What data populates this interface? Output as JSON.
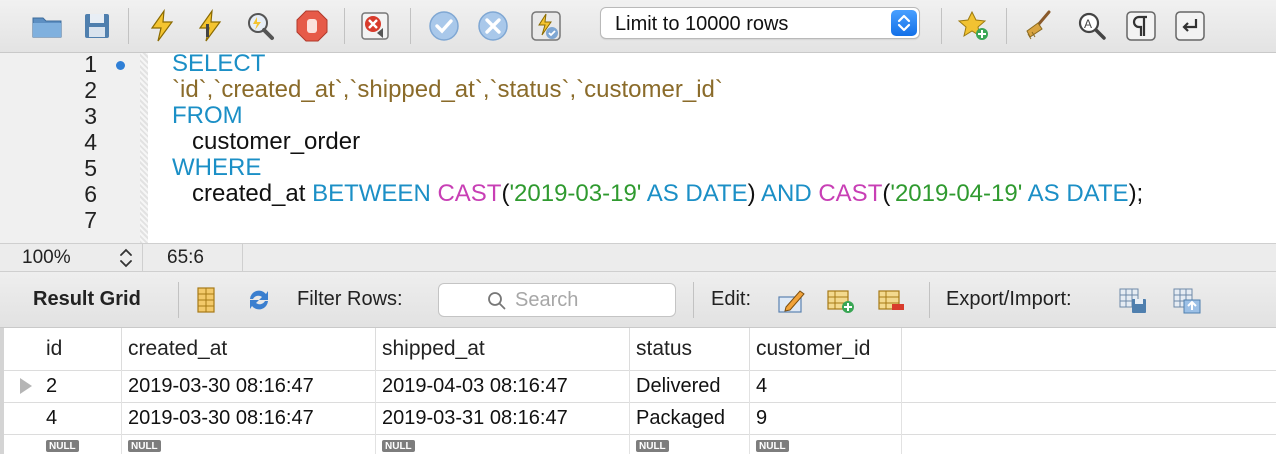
{
  "toolbar": {
    "icons": [
      "open-folder-icon",
      "save-icon",
      "execute-icon",
      "execute-current-icon",
      "explain-icon",
      "stop-icon",
      "toggle-error-icon",
      "commit-icon",
      "rollback-icon",
      "autocommit-icon",
      "add-snippet-icon",
      "beautify-icon",
      "find-icon",
      "invisible-chars-icon",
      "word-wrap-icon"
    ],
    "limit_label": "Limit to 10000 rows"
  },
  "editor": {
    "line_numbers": [
      "1",
      "2",
      "3",
      "4",
      "5",
      "6",
      "7"
    ],
    "lines": [
      [
        {
          "t": "SELECT",
          "c": "kw"
        }
      ],
      [
        {
          "t": "`id`,`created_at`,`shipped_at`,`status`,`customer_id`",
          "c": "bt"
        }
      ],
      [
        {
          "t": "FROM",
          "c": "kw"
        }
      ],
      [
        {
          "t": "   customer_order",
          "c": ""
        }
      ],
      [
        {
          "t": "WHERE",
          "c": "kw"
        }
      ],
      [
        {
          "t": "   created_at ",
          "c": ""
        },
        {
          "t": "BETWEEN ",
          "c": "kw"
        },
        {
          "t": "CAST",
          "c": "fn"
        },
        {
          "t": "(",
          "c": ""
        },
        {
          "t": "'2019-03-19'",
          "c": "str"
        },
        {
          "t": " AS DATE",
          "c": "kw"
        },
        {
          "t": ") ",
          "c": ""
        },
        {
          "t": "AND ",
          "c": "kw"
        },
        {
          "t": "CAST",
          "c": "fn"
        },
        {
          "t": "(",
          "c": ""
        },
        {
          "t": "'2019-04-19'",
          "c": "str"
        },
        {
          "t": " AS DATE",
          "c": "kw"
        },
        {
          "t": ");",
          "c": ""
        }
      ],
      []
    ]
  },
  "status": {
    "zoom": "100%",
    "cursor": "65:6"
  },
  "result_toolbar": {
    "title": "Result Grid",
    "filter_label": "Filter Rows:",
    "search_placeholder": "Search",
    "edit_label": "Edit:",
    "export_label": "Export/Import:"
  },
  "grid": {
    "columns": [
      "id",
      "created_at",
      "shipped_at",
      "status",
      "customer_id"
    ],
    "rows": [
      [
        "2",
        "2019-03-30 08:16:47",
        "2019-04-03 08:16:47",
        "Delivered",
        "4"
      ],
      [
        "4",
        "2019-03-30 08:16:47",
        "2019-03-31 08:16:47",
        "Packaged",
        "9"
      ]
    ],
    "null_label": "NULL"
  }
}
